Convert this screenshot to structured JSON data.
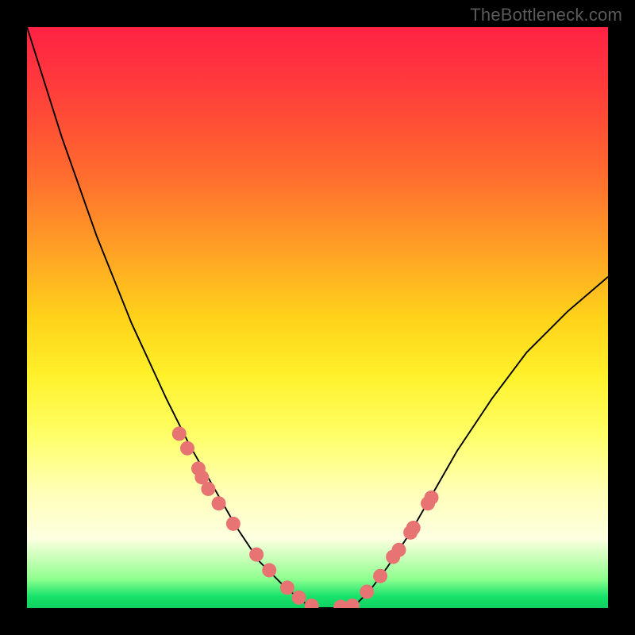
{
  "watermark": "TheBottleneck.com",
  "chart_data": {
    "type": "line",
    "title": "",
    "xlabel": "",
    "ylabel": "",
    "xlim": [
      0,
      1
    ],
    "ylim": [
      0,
      1
    ],
    "left_curve": {
      "x": [
        0.0,
        0.06,
        0.12,
        0.18,
        0.24,
        0.28,
        0.32,
        0.36,
        0.4,
        0.44,
        0.47,
        0.49
      ],
      "y": [
        0.0,
        0.19,
        0.36,
        0.51,
        0.64,
        0.72,
        0.79,
        0.86,
        0.92,
        0.96,
        0.985,
        1.0
      ]
    },
    "plateau": {
      "x": [
        0.49,
        0.56
      ],
      "y": [
        1.0,
        1.0
      ]
    },
    "right_curve": {
      "x": [
        0.56,
        0.59,
        0.62,
        0.66,
        0.7,
        0.74,
        0.8,
        0.86,
        0.93,
        1.0
      ],
      "y": [
        1.0,
        0.97,
        0.93,
        0.87,
        0.8,
        0.73,
        0.64,
        0.56,
        0.49,
        0.43
      ]
    },
    "left_dots": {
      "x": [
        0.262,
        0.276,
        0.295,
        0.301,
        0.312,
        0.33,
        0.355,
        0.395,
        0.417,
        0.448,
        0.468,
        0.49
      ],
      "y": [
        0.7,
        0.725,
        0.76,
        0.775,
        0.795,
        0.82,
        0.855,
        0.908,
        0.935,
        0.965,
        0.982,
        0.996
      ]
    },
    "right_dots": {
      "x": [
        0.54,
        0.56,
        0.585,
        0.608,
        0.63,
        0.64,
        0.66,
        0.665,
        0.69,
        0.696
      ],
      "y": [
        0.998,
        0.996,
        0.972,
        0.945,
        0.912,
        0.9,
        0.87,
        0.862,
        0.82,
        0.81
      ]
    },
    "dot_color": "#e77472",
    "dot_radius_px": 9
  }
}
